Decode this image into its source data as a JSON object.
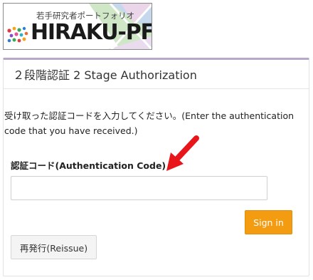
{
  "logo": {
    "subtitle": "若手研究者ポートフォリオ",
    "name": "HIRAKU-PF"
  },
  "panel": {
    "title": "２段階認証 2 Stage Authorization",
    "message": "受け取った認証コードを入力してください。(Enter the authentication code that you have received.)",
    "code_label": "認証コード(Authentication Code)",
    "code_value": "",
    "code_placeholder": "",
    "signin_label": "Sign in",
    "reissue_label": "再発行(Reissue)"
  },
  "colors": {
    "accent": "#f39c12",
    "panel_border_top": "#b8a7c9",
    "annotation_arrow": "#e8151b"
  },
  "icons": [
    "logo-dots-mark",
    "red-annotation-arrow"
  ]
}
